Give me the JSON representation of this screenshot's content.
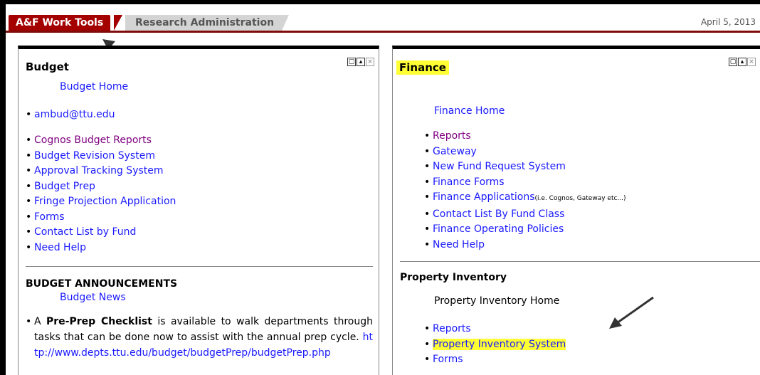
{
  "tabs": {
    "active": "A&F Work Tools",
    "inactive": "Research Administration",
    "date": "April 5, 2013"
  },
  "budget": {
    "title": "Budget",
    "home": "Budget Home",
    "email": "ambud@ttu.edu",
    "links": [
      "Cognos Budget Reports",
      "Budget Revision System",
      "Approval Tracking System",
      "Budget Prep",
      "Fringe Projection Application",
      "Forms",
      "Contact List by Fund",
      "Need Help"
    ],
    "announcements_title": "BUDGET ANNOUNCEMENTS",
    "news": "Budget News",
    "announce_prefix": "A ",
    "announce_bold": "Pre-Prep Checklist",
    "announce_text": " is available to walk departments through tasks that can be done now to assist with the annual prep cycle. ",
    "announce_url": "http://www.depts.ttu.edu/budget/budgetPrep/budgetPrep.php"
  },
  "finance": {
    "title": "Finance",
    "home": "Finance Home",
    "links": [
      "Reports",
      "Gateway",
      "New Fund Request System",
      "Finance Forms",
      "Finance Applications",
      "Contact List By Fund Class",
      "Finance Operating Policies",
      "Need Help"
    ],
    "applications_note": "(i.e. Cognos, Gateway etc...)"
  },
  "property": {
    "title": "Property Inventory",
    "home": "Property Inventory Home",
    "links": [
      "Reports",
      "Property Inventory System",
      "Forms"
    ]
  },
  "icons": [
    "restore-icon",
    "minimize-icon",
    "close-icon",
    "arrow-annotation-icon"
  ],
  "colors": {
    "tab_active": "#a40000",
    "highlight": "#ffff33",
    "link": "#1a1aff",
    "visited": "#800080"
  }
}
